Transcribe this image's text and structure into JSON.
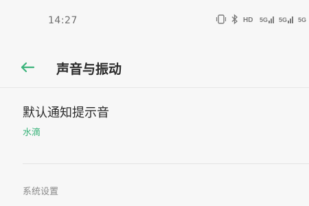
{
  "status_bar": {
    "time": "14:27",
    "icons": [
      "vibrate-icon",
      "bluetooth-icon",
      "hd-icon",
      "signal-5g-icon",
      "signal-5g-icon",
      "signal-5g-icon"
    ]
  },
  "header": {
    "back_icon": "back-arrow-icon",
    "title": "声音与振动"
  },
  "settings": [
    {
      "title": "默认通知提示音",
      "value": "水滴"
    }
  ],
  "section": {
    "label": "系统设置"
  },
  "colors": {
    "accent": "#3ab37a",
    "background": "#f7f7f7",
    "text_primary": "#2a2a2a",
    "text_secondary": "#8a8a8a"
  }
}
